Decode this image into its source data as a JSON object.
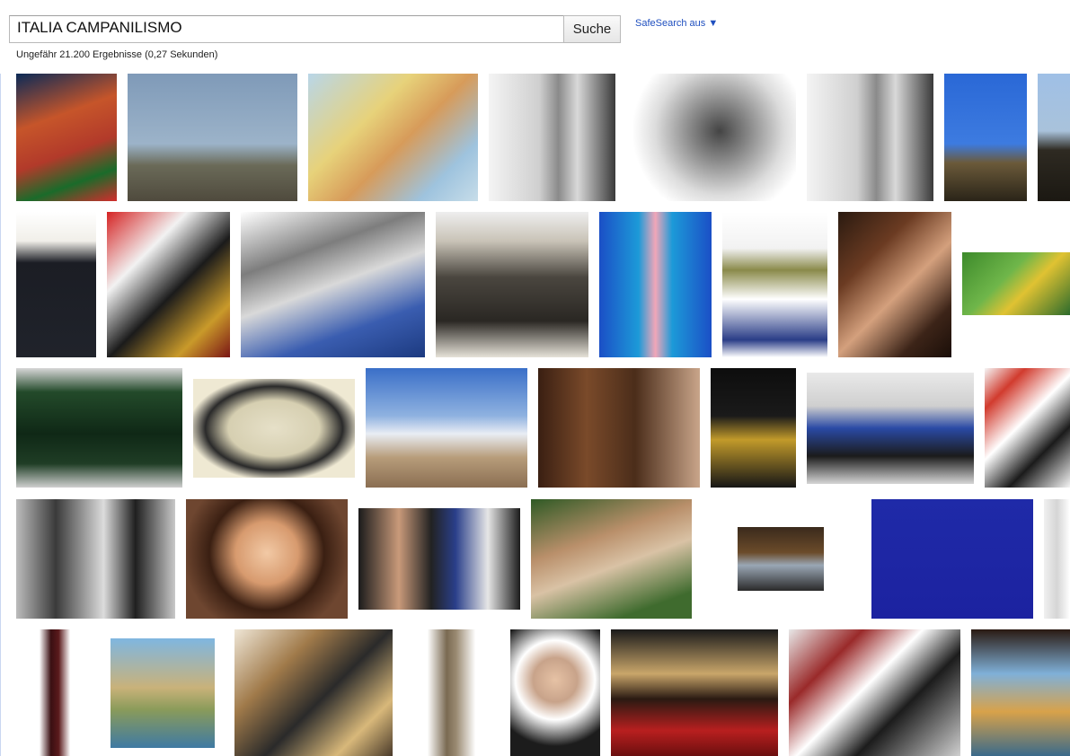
{
  "search": {
    "query": "ITALIA CAMPANILISMO",
    "button_label": "Suche",
    "safesearch_label": "SafeSearch aus ▼"
  },
  "results": {
    "stats": "Ungefähr 21.200 Ergebnisse (0,27 Sekunden)"
  },
  "colors": {
    "link": "#1f4fbf",
    "divider": "#c9d7f1"
  }
}
